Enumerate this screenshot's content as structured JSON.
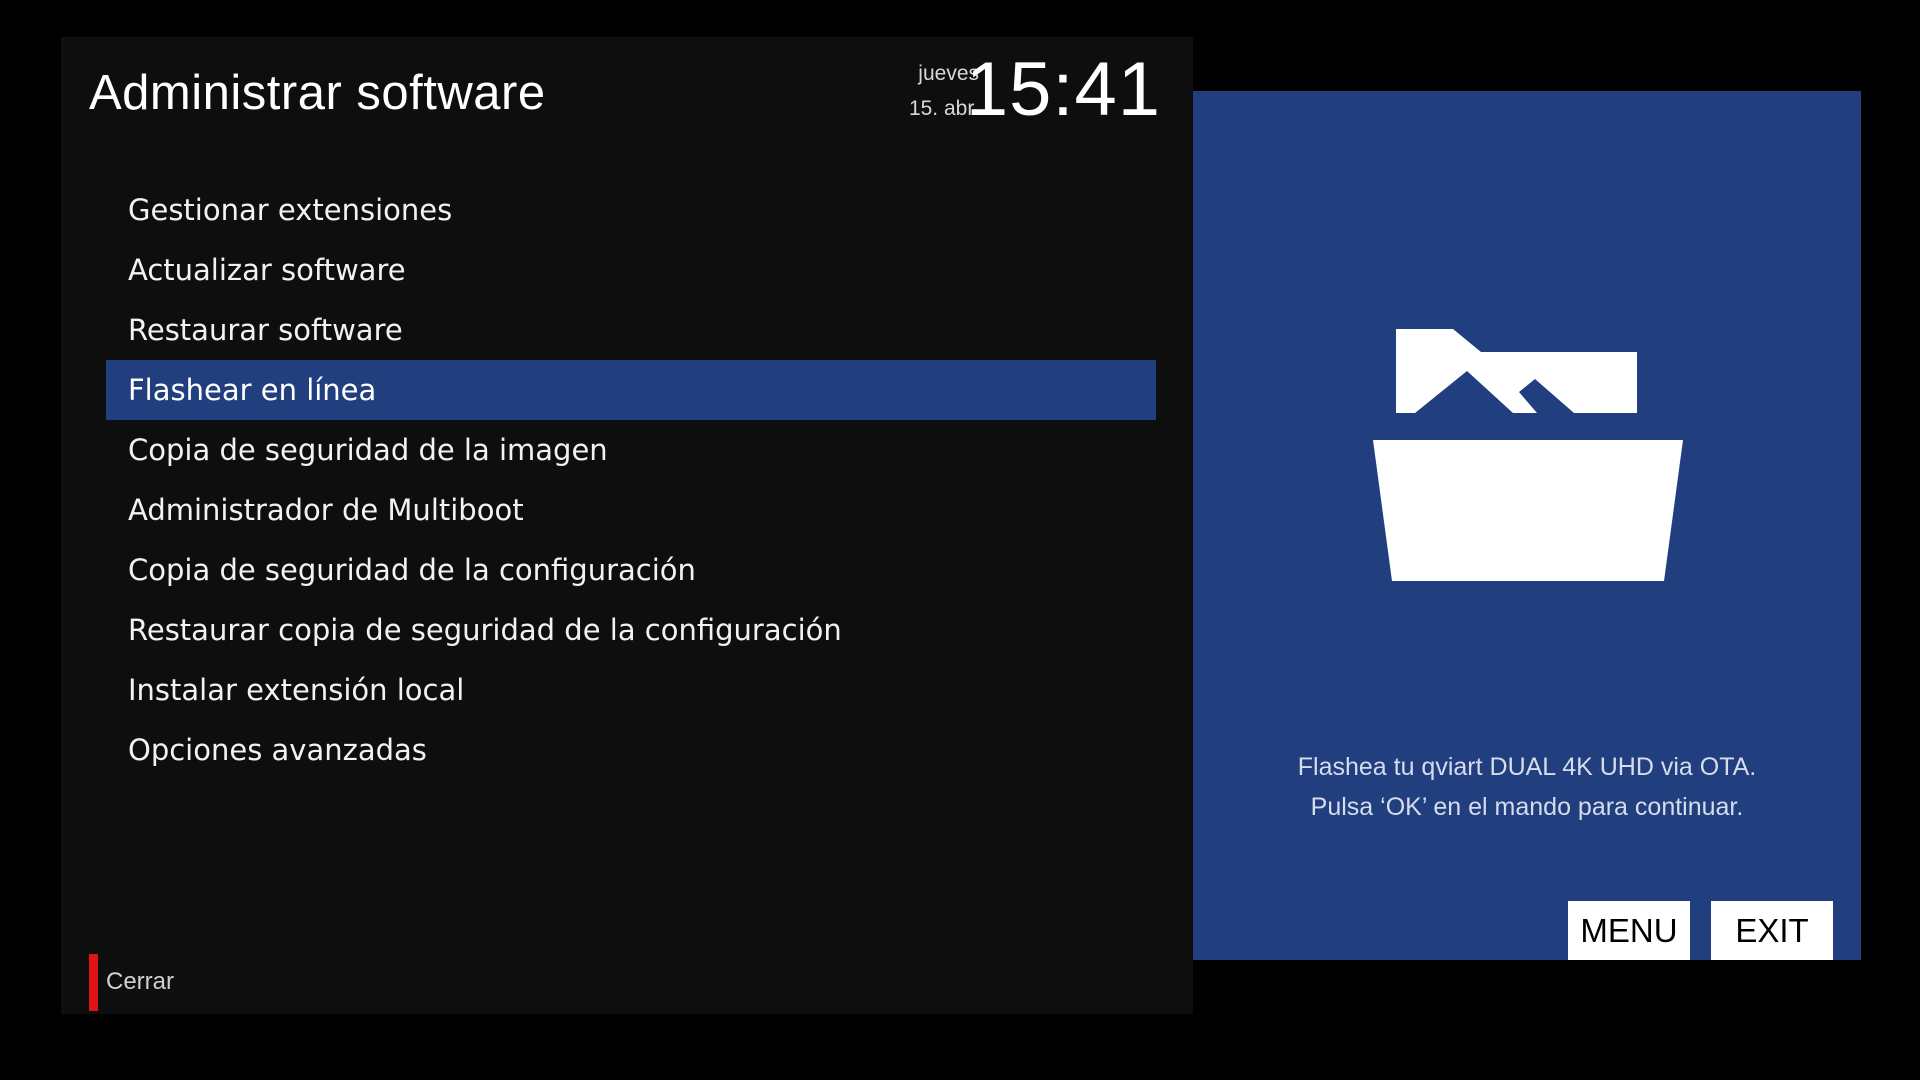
{
  "header": {
    "title": "Administrar software",
    "weekday": "jueves",
    "date": "15. abr.",
    "time": "15:41"
  },
  "menu": {
    "items": [
      {
        "label": "Gestionar extensiones",
        "selected": false
      },
      {
        "label": "Actualizar software",
        "selected": false
      },
      {
        "label": "Restaurar software",
        "selected": false
      },
      {
        "label": "Flashear en línea",
        "selected": true
      },
      {
        "label": "Copia de seguridad de la imagen",
        "selected": false
      },
      {
        "label": "Administrador de Multiboot",
        "selected": false
      },
      {
        "label": "Copia de seguridad de la configuración",
        "selected": false
      },
      {
        "label": "Restaurar copia de seguridad de la configuración",
        "selected": false
      },
      {
        "label": "Instalar extensión local",
        "selected": false
      },
      {
        "label": "Opciones avanzadas",
        "selected": false
      }
    ]
  },
  "footer": {
    "close_label": "Cerrar",
    "close_color": "#e01414"
  },
  "info_panel": {
    "icon": "open-folder-icon",
    "line1": "Flashea tu qviart DUAL 4K UHD via OTA.",
    "line2": "Pulsa ‘OK’ en el mando para continuar.",
    "background": "#213e7f"
  },
  "keys": {
    "menu_label": "MENU",
    "exit_label": "EXIT"
  },
  "colors": {
    "selection": "#213e7f",
    "panel_bg": "#0e0e0e"
  }
}
